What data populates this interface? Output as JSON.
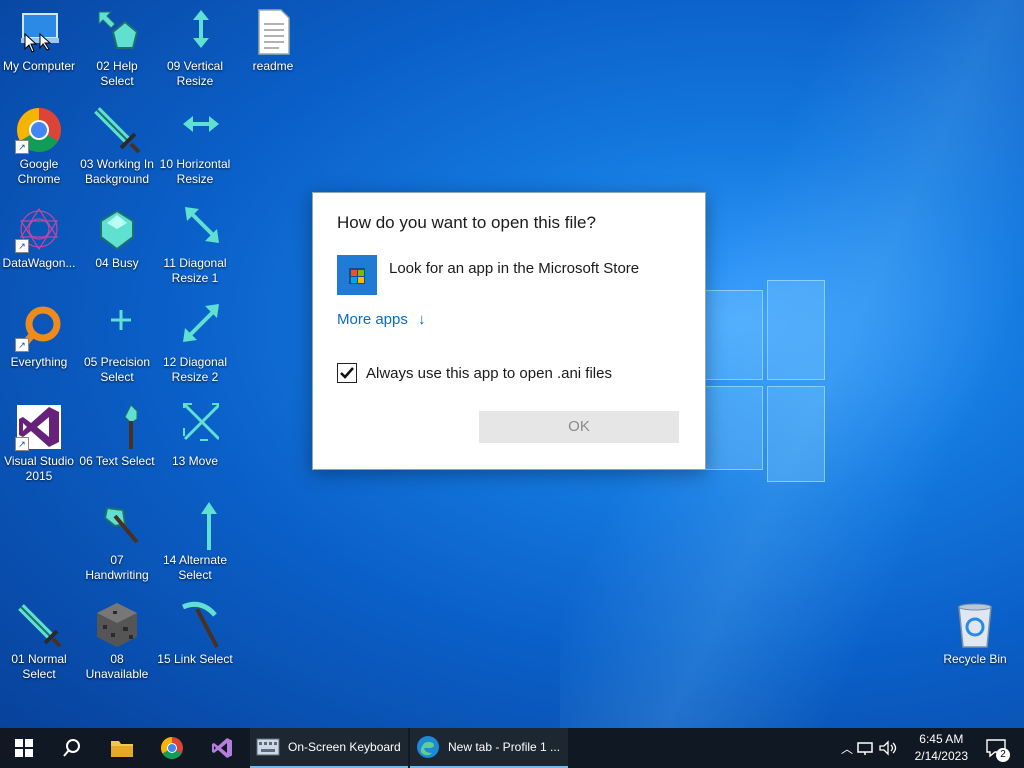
{
  "desktop_icons": {
    "my_computer": "My Computer",
    "help_select": "02 Help Select",
    "vertical_resize": "09 Vertical Resize",
    "readme": "readme",
    "google_chrome": "Google Chrome",
    "working_bg": "03 Working In Background",
    "horizontal_resize": "10 Horizontal Resize",
    "datawagon": "DataWagon...",
    "busy": "04 Busy",
    "diag_resize_1": "11 Diagonal Resize 1",
    "everything": "Everything",
    "precision_select": "05 Precision Select",
    "diag_resize_2": "12 Diagonal Resize 2",
    "visual_studio": "Visual Studio 2015",
    "text_select": "06 Text Select",
    "move": "13 Move",
    "handwriting": "07 Handwriting",
    "alternate_select": "14 Alternate Select",
    "normal_select": "01 Normal Select",
    "unavailable": "08 Unavailable",
    "link_select": "15 Link Select",
    "recycle_bin": "Recycle Bin"
  },
  "dialog": {
    "title": "How do you want to open this file?",
    "store_option": "Look for an app in the Microsoft Store",
    "more_apps": "More apps",
    "more_apps_arrow": "↓",
    "checkbox_label": "Always use this app to open .ani files",
    "checkbox_checked": true,
    "ok_label": "OK"
  },
  "taskbar": {
    "apps": [
      {
        "label": "On-Screen Keyboard"
      },
      {
        "label": "New tab - Profile 1 ..."
      }
    ],
    "time": "6:45 AM",
    "date": "2/14/2023",
    "notification_count": "2"
  },
  "colors": {
    "accent": "#0a6cc8",
    "diamond": "#5fe0d0",
    "taskbar": "#101923"
  }
}
